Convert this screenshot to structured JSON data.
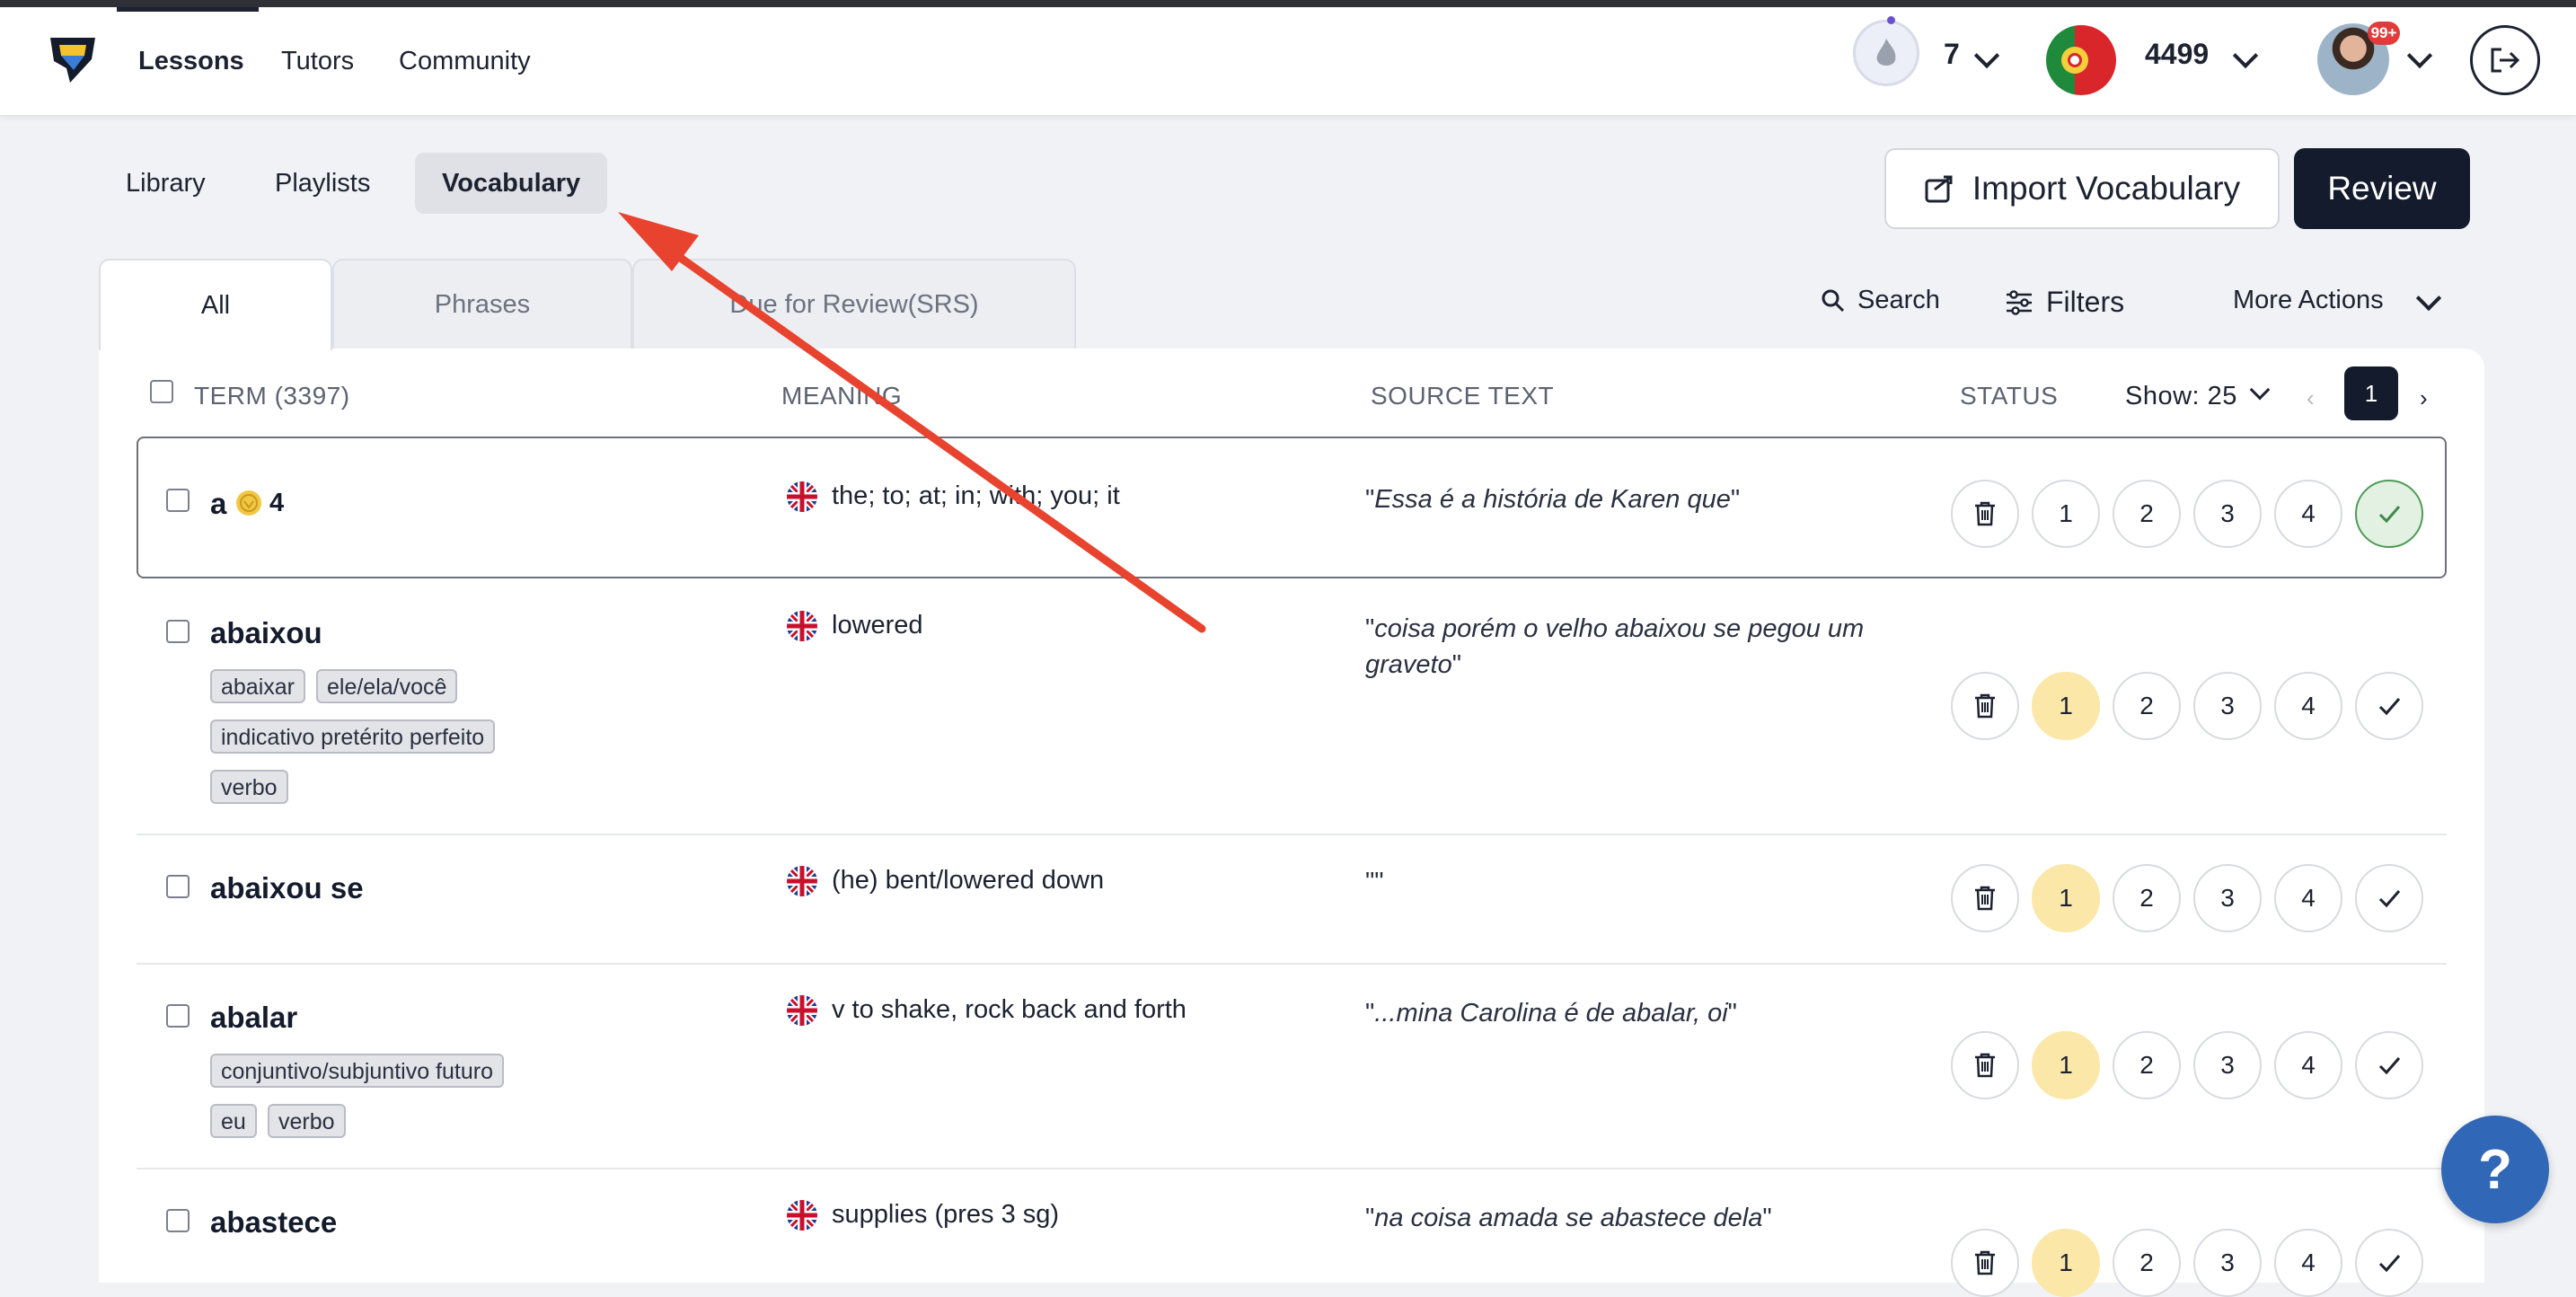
{
  "nav": {
    "links": [
      "Lessons",
      "Tutors",
      "Community"
    ],
    "streak": "7",
    "coins": "4499",
    "notifications": "99+"
  },
  "subtabs": [
    "Library",
    "Playlists",
    "Vocabulary"
  ],
  "actions": {
    "import": "Import Vocabulary",
    "review": "Review"
  },
  "filter_tabs": [
    "All",
    "Phrases",
    "Due for Review(SRS)"
  ],
  "tools": {
    "search": "Search",
    "filters": "Filters",
    "more": "More Actions"
  },
  "table": {
    "headers": {
      "term": "TERM (3397)",
      "meaning": "MEANING",
      "source": "SOURCE TEXT",
      "status": "STATUS"
    },
    "show": "Show: 25",
    "page": "1",
    "prev": "‹",
    "next": "›",
    "rows": [
      {
        "term": "a",
        "count": "4",
        "tags": [],
        "meaning": "the; to; at; in; with; you; it",
        "source": "Essa é a história de Karen que",
        "status": "known"
      },
      {
        "term": "abaixou",
        "tags": [
          "abaixar",
          "ele/ela/você",
          "indicativo pretérito perfeito",
          "verbo"
        ],
        "meaning": "lowered",
        "source": "coisa porém o velho abaixou se pegou um graveto",
        "status": "1"
      },
      {
        "term": "abaixou se",
        "tags": [],
        "meaning": "(he) bent/lowered down",
        "source": "",
        "status": "1"
      },
      {
        "term": "abalar",
        "tags": [
          "conjuntivo/subjuntivo futuro",
          "eu",
          "verbo"
        ],
        "meaning": "v to shake, rock back and forth",
        "source": "...mina Carolina é de abalar, oi",
        "status": "1"
      },
      {
        "term": "abastece",
        "tags": [],
        "meaning": "supplies (pres 3 sg)",
        "source": "na coisa amada se abastece dela",
        "status": "1"
      }
    ],
    "status_levels": [
      "1",
      "2",
      "3",
      "4"
    ]
  },
  "help": "?"
}
